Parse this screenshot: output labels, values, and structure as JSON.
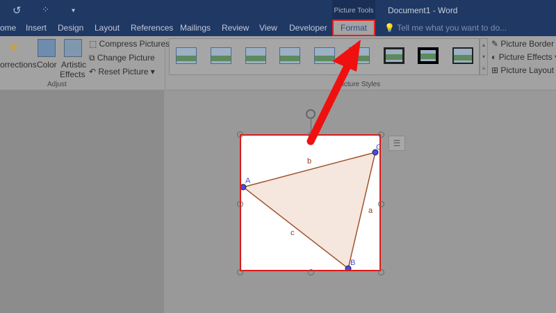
{
  "titlebar": {
    "picture_tools": "Picture Tools",
    "document_title": "Document1 - Word",
    "undo_icon": "↺",
    "touch_icon": "⁘",
    "customize_icon": "▾"
  },
  "tabs": [
    "ome",
    "Insert",
    "Design",
    "Layout",
    "References",
    "Mailings",
    "Review",
    "View",
    "Developer"
  ],
  "format_tab": "Format",
  "tell_me": "Tell me what you want to do...",
  "adjust": {
    "corrections": "orrections",
    "color": "Color",
    "artistic1": "Artistic",
    "artistic2": "Effects",
    "compress": "Compress Pictures",
    "change": "Change Picture",
    "reset": "Reset Picture",
    "label": "Adjust"
  },
  "picture_styles": {
    "label": "Picture Styles",
    "border": "Picture Border",
    "effects": "Picture Effects",
    "layout": "Picture Layout"
  },
  "diagram": {
    "points": {
      "A": "A",
      "B": "B",
      "C": "C"
    },
    "sides": {
      "a": "a",
      "b": "b",
      "c": "c"
    }
  },
  "colors": {
    "accent": "#d81b1b",
    "title": "#1f3864"
  }
}
